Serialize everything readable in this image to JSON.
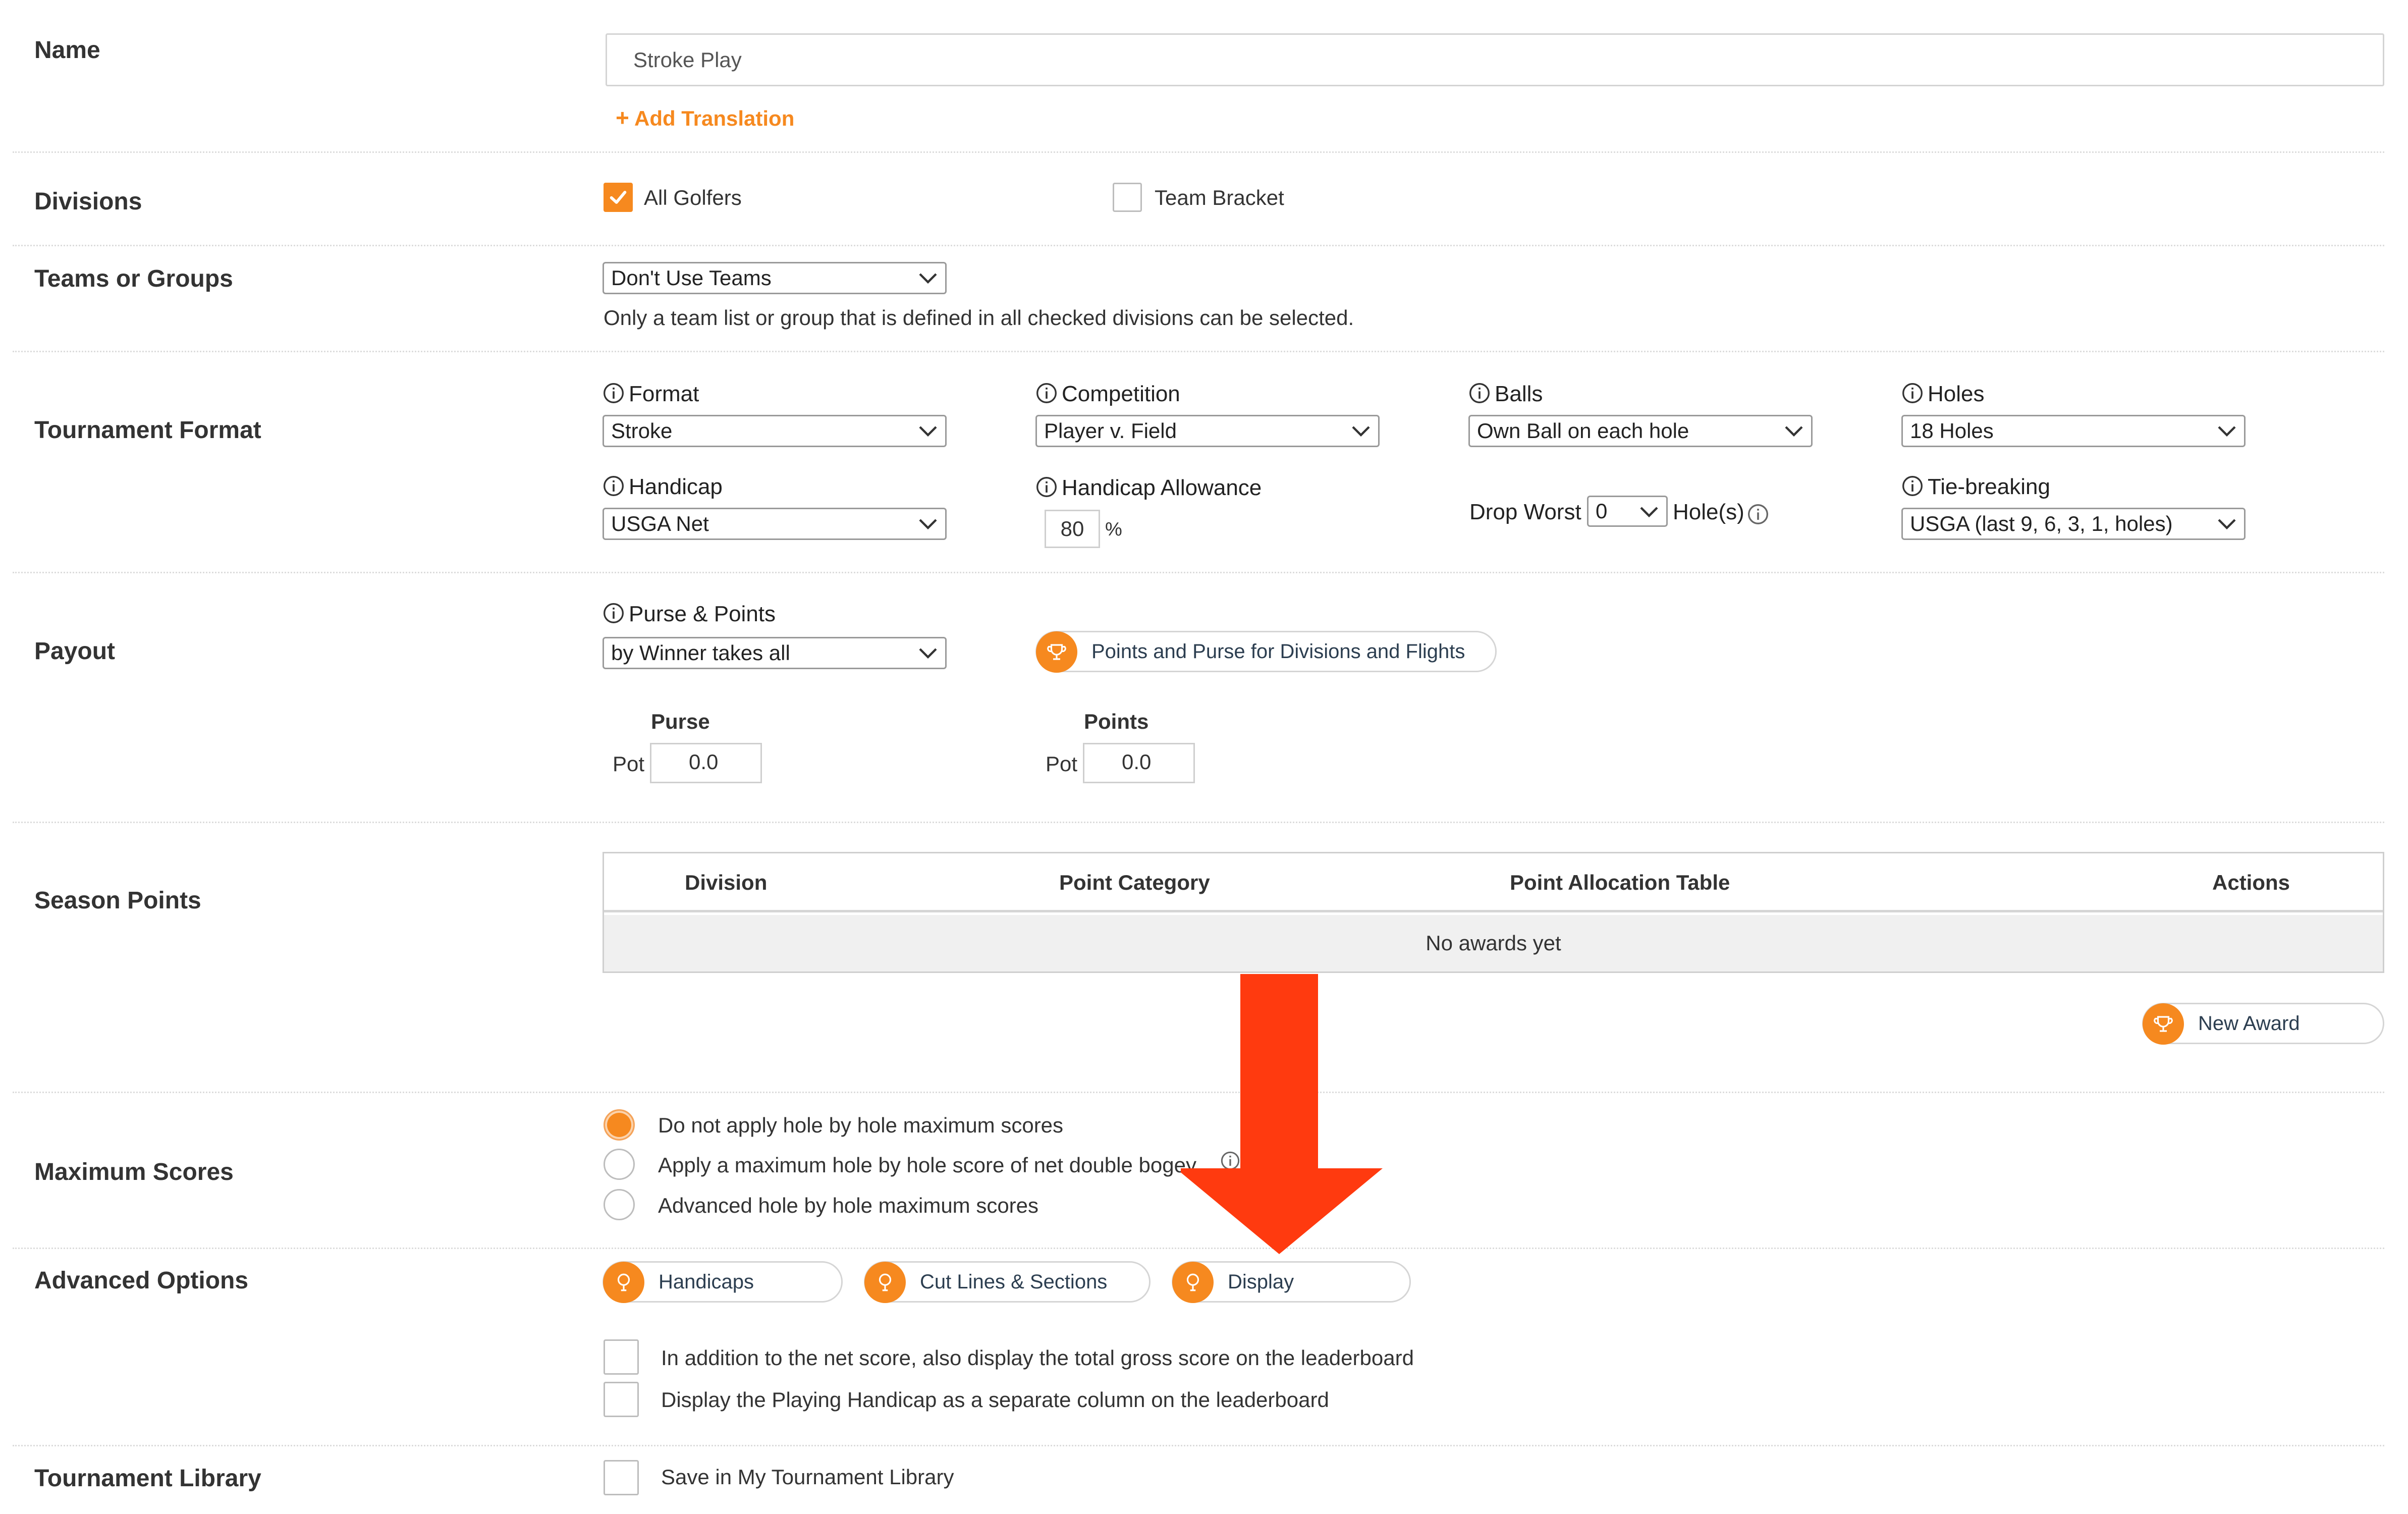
{
  "rows": {
    "name": "Name",
    "divisions": "Divisions",
    "teams": "Teams or Groups",
    "format": "Tournament Format",
    "payout": "Payout",
    "season": "Season Points",
    "maxscores": "Maximum Scores",
    "advanced": "Advanced Options",
    "library": "Tournament Library"
  },
  "name_field": {
    "value": "Stroke Play",
    "add_translation": "Add Translation"
  },
  "divisions": {
    "all_golfers": "All Golfers",
    "team_bracket": "Team Bracket",
    "all_golfers_checked": true,
    "team_bracket_checked": false
  },
  "teams": {
    "selected": "Don't Use Teams",
    "help": "Only a team list or group that is defined in all checked divisions can be selected."
  },
  "format": {
    "format_label": "Format",
    "format_value": "Stroke",
    "competition_label": "Competition",
    "competition_value": "Player v. Field",
    "balls_label": "Balls",
    "balls_value": "Own Ball on each hole",
    "holes_label": "Holes",
    "holes_value": "18 Holes",
    "handicap_label": "Handicap",
    "handicap_value": "USGA Net",
    "allowance_label": "Handicap Allowance",
    "allowance_value": "80",
    "allowance_unit": "%",
    "drop_worst_label": "Drop Worst",
    "drop_worst_value": "0",
    "drop_worst_suffix": "Hole(s)",
    "tiebreak_label": "Tie-breaking",
    "tiebreak_value": "USGA (last 9, 6, 3, 1, holes)"
  },
  "payout": {
    "purse_points_label": "Purse & Points",
    "purse_points_value": "by Winner takes all",
    "divisions_flights_button": "Points and Purse for Divisions and Flights",
    "purse_heading": "Purse",
    "points_heading": "Points",
    "pot_label": "Pot",
    "purse_pot": "0.0",
    "points_pot": "0.0"
  },
  "season": {
    "columns": [
      "Division",
      "Point Category",
      "Point Allocation Table",
      "Actions"
    ],
    "empty": "No awards yet",
    "new_award": "New Award"
  },
  "maxscores": {
    "options": [
      "Do not apply hole by hole maximum scores",
      "Apply a maximum hole by hole score of net double bogey",
      "Advanced hole by hole maximum scores"
    ],
    "selected_index": 0
  },
  "advanced": {
    "buttons": [
      "Handicaps",
      "Cut Lines & Sections",
      "Display"
    ],
    "checks": [
      "In addition to the net score, also display the total gross score on the leaderboard",
      "Display the Playing Handicap as a separate column on the leaderboard"
    ]
  },
  "library": {
    "save": "Save in My Tournament Library"
  },
  "colors": {
    "accent": "#f6891f",
    "arrow": "#ff3a0f"
  }
}
